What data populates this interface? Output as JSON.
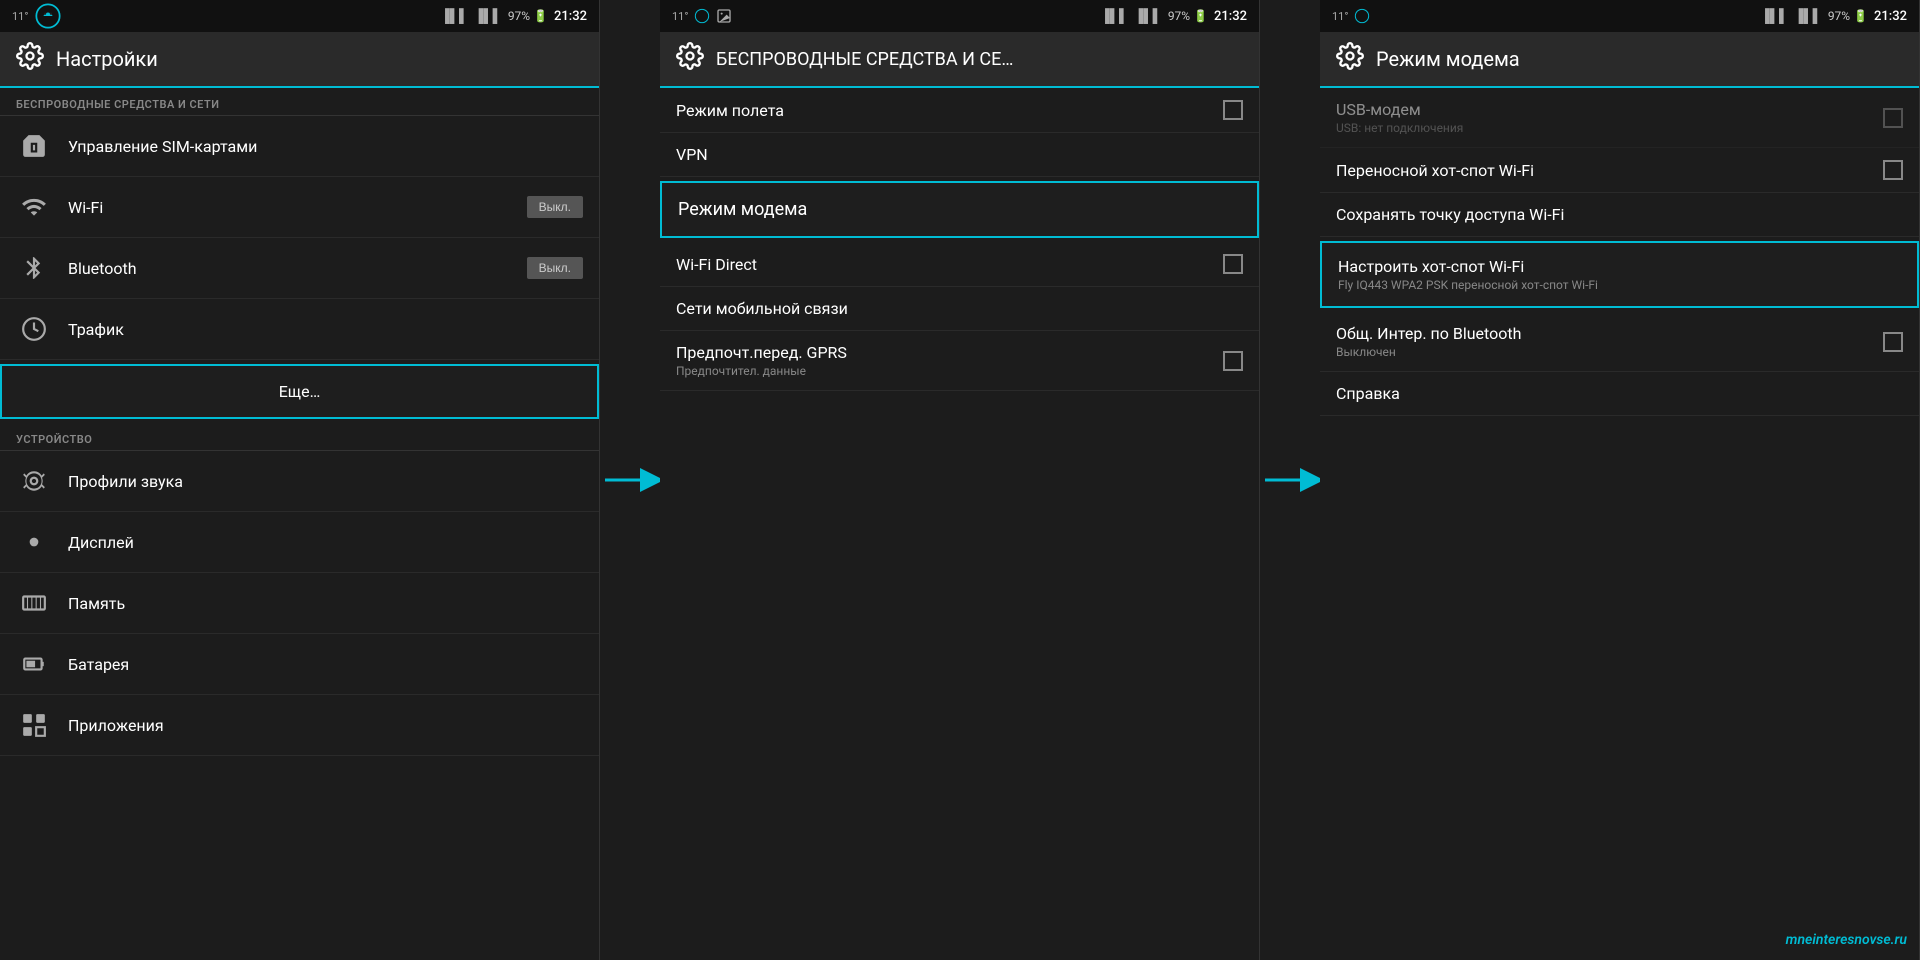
{
  "colors": {
    "accent": "#00bcd4",
    "background": "#1c1c1c",
    "surface": "#2a2a2a",
    "text_primary": "#ffffff",
    "text_secondary": "#888888",
    "toggle_bg": "#555555"
  },
  "panel1": {
    "status": {
      "left_temp": "11°",
      "signal1": "📶",
      "signal2": "📶",
      "battery": "97%",
      "time": "21:32"
    },
    "title": "Настройки",
    "sections": [
      {
        "header": "БЕСПРОВОДНЫЕ СРЕДСТВА И СЕТИ",
        "items": [
          {
            "label": "Управление SIM-картами",
            "icon": "sim",
            "has_toggle": false,
            "has_checkbox": false
          },
          {
            "label": "Wi-Fi",
            "icon": "wifi",
            "toggle": "Выкл.",
            "has_toggle": true
          },
          {
            "label": "Bluetooth",
            "icon": "bluetooth",
            "toggle": "Выкл.",
            "has_toggle": true
          },
          {
            "label": "Трафик",
            "icon": "traffic",
            "has_toggle": false
          },
          {
            "label": "Еще…",
            "icon": "",
            "highlighted": true
          }
        ]
      },
      {
        "header": "УСТРОЙСТВО",
        "items": [
          {
            "label": "Профили звука",
            "icon": "sound"
          },
          {
            "label": "Дисплей",
            "icon": "display"
          },
          {
            "label": "Память",
            "icon": "memory"
          },
          {
            "label": "Батарея",
            "icon": "battery"
          },
          {
            "label": "Приложения",
            "icon": "apps"
          }
        ]
      }
    ]
  },
  "panel2": {
    "title": "БЕСПРОВОДНЫЕ СРЕДСТВА И СЕ…",
    "items": [
      {
        "label": "Режим полета",
        "has_checkbox": true,
        "highlighted": true
      },
      {
        "label": "VPN",
        "has_checkbox": false
      },
      {
        "label": "Режим модема",
        "has_checkbox": false,
        "highlighted": true
      },
      {
        "label": "Wi-Fi Direct",
        "has_checkbox": true
      },
      {
        "label": "Сети мобильной связи",
        "has_checkbox": false
      },
      {
        "label": "Предпочт.перед. GPRS",
        "subtitle": "Предпочтител. данные",
        "has_checkbox": true
      }
    ]
  },
  "panel3": {
    "title": "Режим модема",
    "items": [
      {
        "label": "USB-модем",
        "subtitle": "USB: нет подключения",
        "has_checkbox": true
      },
      {
        "label": "Переносной хот-спот Wi-Fi",
        "has_checkbox": true
      },
      {
        "label": "Сохранять точку доступа Wi-Fi",
        "has_checkbox": false
      },
      {
        "label": "Настроить хот-спот Wi-Fi",
        "subtitle": "Fly IQ443 WPA2 PSK переносной хот-спот Wi-Fi",
        "highlighted": true
      },
      {
        "label": "Общ. Интер. по Bluetooth",
        "subtitle": "Выключен",
        "has_checkbox": true
      },
      {
        "label": "Справка"
      }
    ],
    "watermark": "mneinteresnovse.ru"
  }
}
